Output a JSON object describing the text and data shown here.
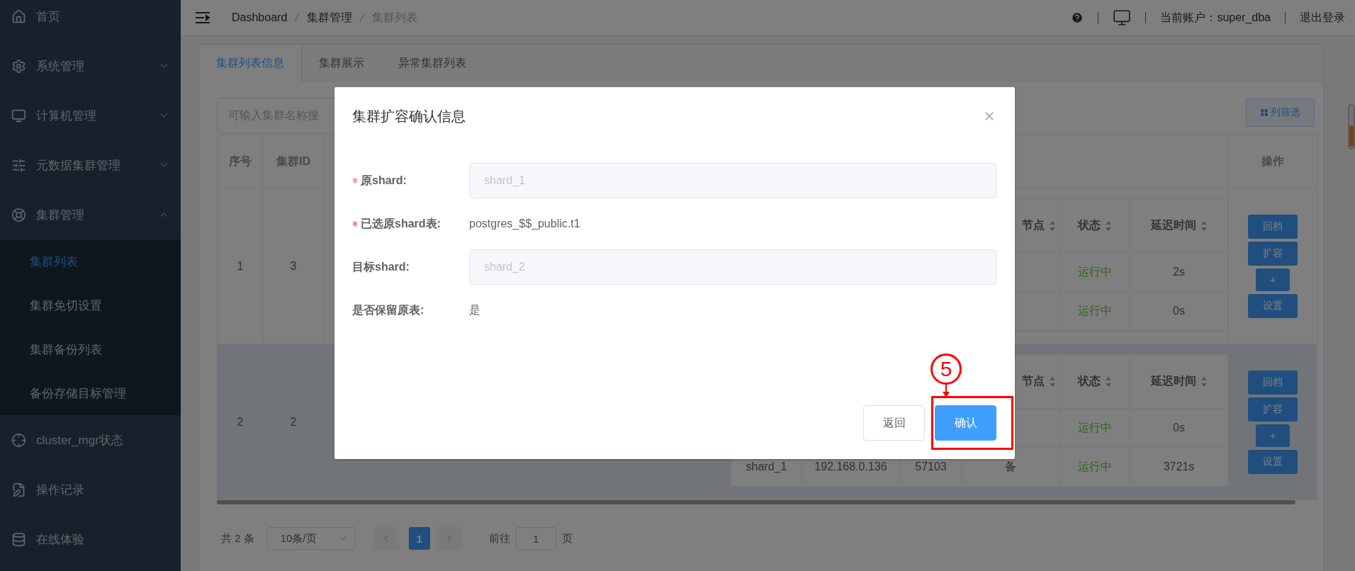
{
  "sidebar": {
    "items": [
      {
        "label": "首页"
      },
      {
        "label": "系统管理",
        "expanded": false
      },
      {
        "label": "计算机管理",
        "expanded": false
      },
      {
        "label": "元数据集群管理",
        "expanded": false
      },
      {
        "label": "集群管理",
        "expanded": true,
        "children": [
          {
            "label": "集群列表",
            "selected": true
          },
          {
            "label": "集群免切设置",
            "selected": false
          },
          {
            "label": "集群备份列表",
            "selected": false
          },
          {
            "label": "备份存储目标管理",
            "selected": false
          }
        ]
      },
      {
        "label": "cluster_mgr状态"
      },
      {
        "label": "操作记录"
      },
      {
        "label": "在线体验"
      }
    ]
  },
  "topbar": {
    "breadcrumb": [
      {
        "label": "Dashboard",
        "current": false
      },
      {
        "label": "集群管理",
        "current": false
      },
      {
        "label": "集群列表",
        "current": true
      }
    ],
    "account": "当前账户：super_dba",
    "logout": "退出登录"
  },
  "tabs": [
    {
      "label": "集群列表信息",
      "selected": true
    },
    {
      "label": "集群展示",
      "selected": false
    },
    {
      "label": "异常集群列表",
      "selected": false
    }
  ],
  "search": {
    "placeholder": "可输入集群名称搜"
  },
  "column_filter_button": "列筛选",
  "table": {
    "columns": [
      "序号",
      "集群ID",
      "操作"
    ],
    "rows": [
      {
        "selected": false,
        "index": "1",
        "cluster_id": "3",
        "nodes": {
          "columns": [
            {
              "label": "节点",
              "sortable": true
            },
            {
              "label": "状态",
              "sortable": true
            },
            {
              "label": "延迟时间",
              "sortable": true
            }
          ],
          "rows": [
            {
              "status": "运行中",
              "delay": "2s"
            },
            {
              "status": "运行中",
              "delay": "0s"
            }
          ]
        },
        "actions": [
          "回档",
          "扩容",
          "+",
          "设置"
        ]
      },
      {
        "selected": true,
        "index": "2",
        "cluster_id": "2",
        "nodes": {
          "columns": [
            {
              "label": "节点",
              "sortable": true
            },
            {
              "label": "状态",
              "sortable": true
            },
            {
              "label": "延迟时间",
              "sortable": true
            }
          ],
          "rows": [
            {
              "status": "运行中",
              "delay": "0s"
            },
            {
              "shard": "shard_1",
              "ip": "192.168.0.136",
              "port": "57103",
              "role": "备",
              "status": "运行中",
              "delay": "3721s"
            }
          ]
        },
        "actions": [
          "回档",
          "扩容",
          "+",
          "设置"
        ]
      }
    ]
  },
  "pagination": {
    "total": "共 2 条",
    "page_size": "10条/页",
    "pages": [
      {
        "label": "1",
        "selected": true
      }
    ],
    "goto_label": "前往",
    "goto_value": "1",
    "goto_suffix": "页"
  },
  "dialog": {
    "title": "集群扩容确认信息",
    "fields": [
      {
        "kind": "input",
        "label": "原shard:",
        "required": true,
        "value": "shard_1",
        "disabled": true
      },
      {
        "kind": "text",
        "label": "已选原shard表:",
        "required": true,
        "value": "postgres_$$_public.t1"
      },
      {
        "kind": "input",
        "label": "目标shard:",
        "required": false,
        "value": "shard_2",
        "disabled": true
      },
      {
        "kind": "text",
        "label": "是否保留原表:",
        "required": false,
        "value": "是"
      }
    ],
    "buttons": [
      {
        "label": "返回",
        "kind": "default"
      },
      {
        "label": "确认",
        "kind": "primary"
      }
    ]
  },
  "annotation": {
    "step": "5"
  }
}
